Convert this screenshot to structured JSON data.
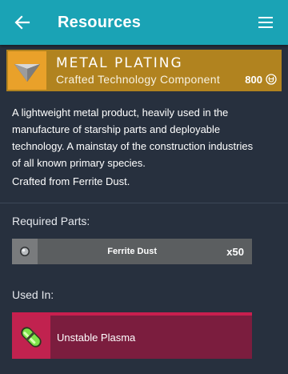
{
  "appbar": {
    "title": "Resources",
    "back_icon": "arrow-left-icon",
    "menu_icon": "hamburger-menu-icon",
    "color": "#1aa3b5"
  },
  "item": {
    "name": "METAL PLATING",
    "category": "Crafted Technology Component",
    "price": "800",
    "currency_icon": "units-currency-icon",
    "header_color": "#b1831f",
    "description": "A lightweight metal product, heavily used in the manufacture of starship parts and deployable technology. A mainstay of the construction industries of all known primary species.",
    "crafted_from": "Crafted from Ferrite Dust."
  },
  "required_parts": {
    "label": "Required Parts:",
    "items": [
      {
        "name": "Ferrite Dust",
        "quantity": "x50",
        "icon": "ferrite-dust-icon"
      }
    ]
  },
  "used_in": {
    "label": "Used In:",
    "items": [
      {
        "name": "Unstable Plasma",
        "icon": "unstable-plasma-icon",
        "color": "#7b1d3e"
      }
    ]
  }
}
